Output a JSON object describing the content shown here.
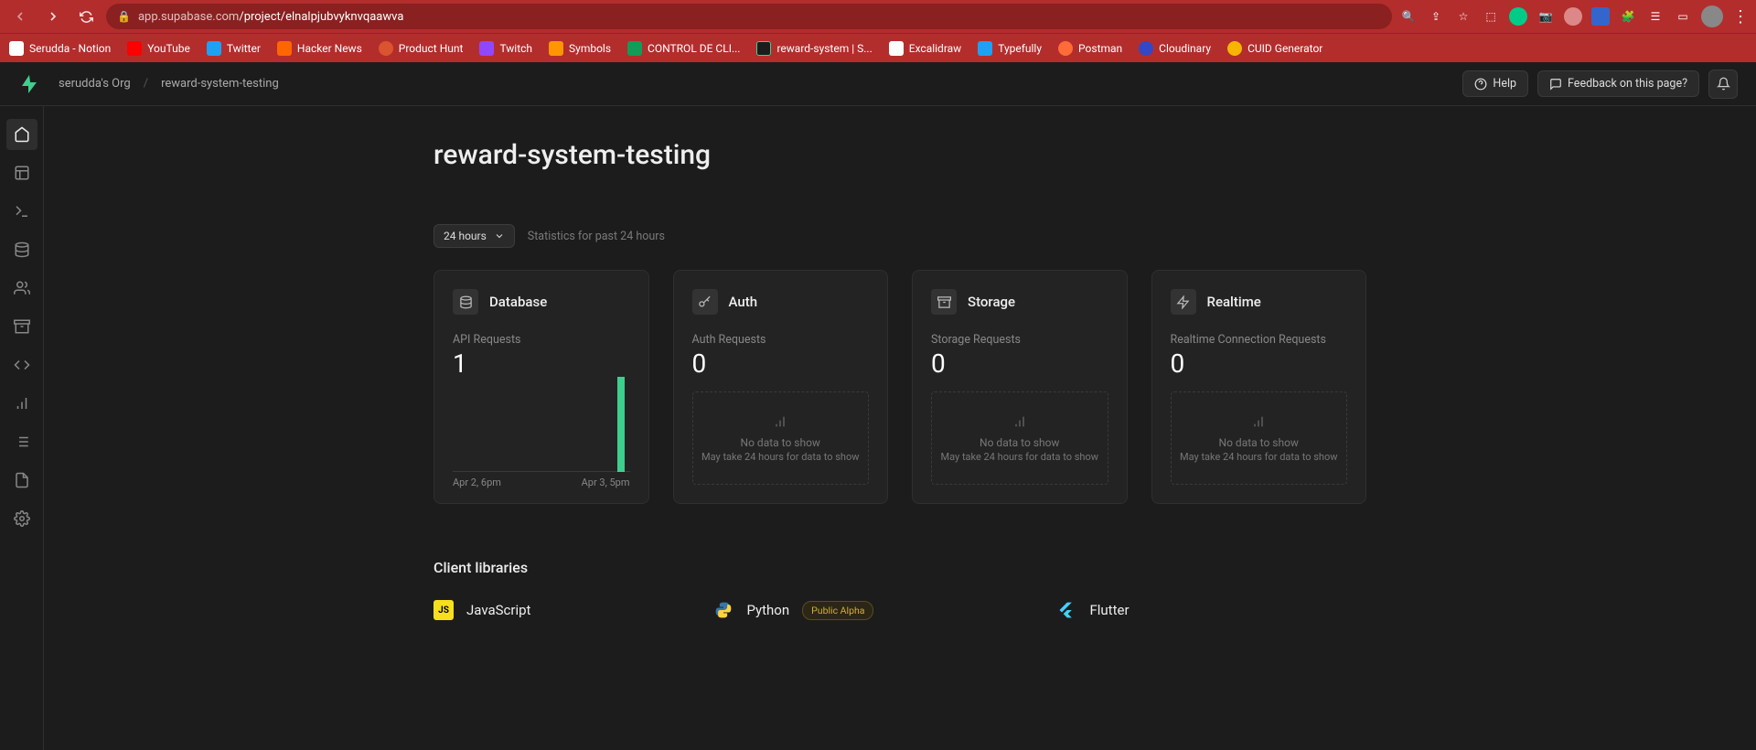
{
  "browser": {
    "url_host": "app.supabase.com",
    "url_path": "/project/elnalpjubvyknvqaawva"
  },
  "bookmarks": [
    {
      "label": "Serudda - Notion",
      "color": "#fff"
    },
    {
      "label": "YouTube",
      "color": "#ff0000"
    },
    {
      "label": "Twitter",
      "color": "#1da1f2"
    },
    {
      "label": "Hacker News",
      "color": "#ff6600"
    },
    {
      "label": "Product Hunt",
      "color": "#da552f"
    },
    {
      "label": "Twitch",
      "color": "#9146ff"
    },
    {
      "label": "Symbols",
      "color": "#ff9500"
    },
    {
      "label": "CONTROL DE CLI...",
      "color": "#0f9d58"
    },
    {
      "label": "reward-system | S...",
      "color": "#3ecf8e"
    },
    {
      "label": "Excalidraw",
      "color": "#6965db"
    },
    {
      "label": "Typefully",
      "color": "#1da1f2"
    },
    {
      "label": "Postman",
      "color": "#ff6c37"
    },
    {
      "label": "Cloudinary",
      "color": "#3448c5"
    },
    {
      "label": "CUID Generator",
      "color": "#f7b500"
    }
  ],
  "topbar": {
    "org": "serudda's Org",
    "project": "reward-system-testing",
    "help": "Help",
    "feedback": "Feedback on this page?"
  },
  "page": {
    "title": "reward-system-testing",
    "time_range": "24 hours",
    "stats_label": "Statistics for past 24 hours"
  },
  "cards": {
    "database": {
      "title": "Database",
      "metric_label": "API Requests",
      "metric_value": "1",
      "date_from": "Apr 2, 6pm",
      "date_to": "Apr 3, 5pm"
    },
    "auth": {
      "title": "Auth",
      "metric_label": "Auth Requests",
      "metric_value": "0",
      "empty_title": "No data to show",
      "empty_sub": "May take 24 hours for data to show"
    },
    "storage": {
      "title": "Storage",
      "metric_label": "Storage Requests",
      "metric_value": "0",
      "empty_title": "No data to show",
      "empty_sub": "May take 24 hours for data to show"
    },
    "realtime": {
      "title": "Realtime",
      "metric_label": "Realtime Connection Requests",
      "metric_value": "0",
      "empty_title": "No data to show",
      "empty_sub": "May take 24 hours for data to show"
    }
  },
  "chart_data": {
    "type": "bar",
    "title": "API Requests",
    "categories": [
      "Apr 2, 6pm",
      "Apr 3, 5pm"
    ],
    "values": [
      0,
      1
    ],
    "ylim": [
      0,
      1
    ]
  },
  "libs": {
    "heading": "Client libraries",
    "js": "JavaScript",
    "python": "Python",
    "python_badge": "Public Alpha",
    "flutter": "Flutter"
  }
}
